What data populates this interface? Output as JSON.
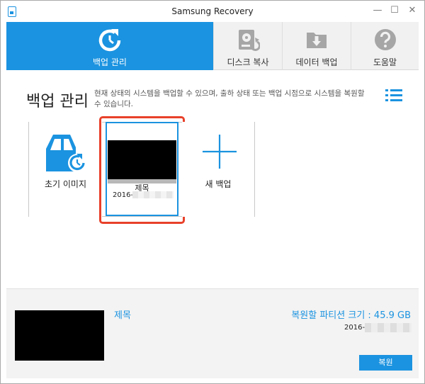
{
  "window": {
    "title": "Samsung Recovery"
  },
  "tabs": {
    "backup_mgmt": {
      "label": "백업 관리",
      "icon": "restore-arrow-icon"
    },
    "disk_copy": {
      "label": "디스크 복사",
      "icon": "disk-copy-icon"
    },
    "data_backup": {
      "label": "데이터 백업",
      "icon": "folder-download-icon"
    },
    "help": {
      "label": "도움말",
      "icon": "question-icon"
    }
  },
  "main": {
    "title": "백업 관리",
    "description": "현재 상태의 시스템을 백업할 수 있으며, 출하 상태 또는 백업 시점으로 시스템을 복원할 수 있습니다.",
    "cards": {
      "initial_image": {
        "label": "초기 이미지"
      },
      "backup": {
        "name": "제목",
        "date_prefix": "2016-"
      },
      "new_backup": {
        "label": "새 백업"
      }
    }
  },
  "details": {
    "title": "제목",
    "partition_size": "복원할 파티션 크기 : 45.9 GB",
    "date_prefix": "2016-",
    "restore_label": "복원"
  },
  "colors": {
    "accent": "#1b93e0",
    "highlight": "#e8412a"
  }
}
